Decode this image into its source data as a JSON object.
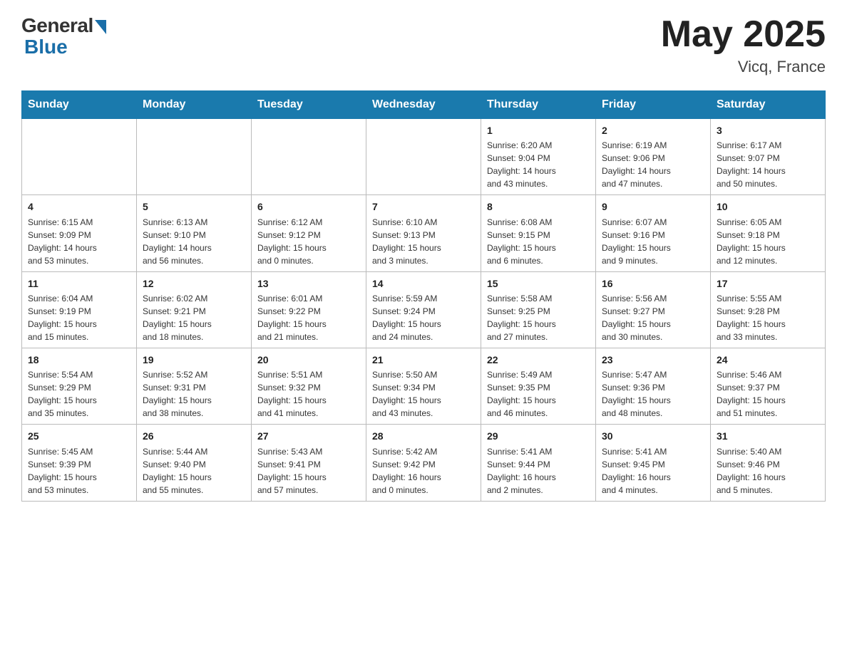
{
  "header": {
    "logo_general": "General",
    "logo_blue": "Blue",
    "month_year": "May 2025",
    "location": "Vicq, France"
  },
  "calendar": {
    "days_of_week": [
      "Sunday",
      "Monday",
      "Tuesday",
      "Wednesday",
      "Thursday",
      "Friday",
      "Saturday"
    ],
    "weeks": [
      [
        {
          "day": "",
          "info": ""
        },
        {
          "day": "",
          "info": ""
        },
        {
          "day": "",
          "info": ""
        },
        {
          "day": "",
          "info": ""
        },
        {
          "day": "1",
          "info": "Sunrise: 6:20 AM\nSunset: 9:04 PM\nDaylight: 14 hours\nand 43 minutes."
        },
        {
          "day": "2",
          "info": "Sunrise: 6:19 AM\nSunset: 9:06 PM\nDaylight: 14 hours\nand 47 minutes."
        },
        {
          "day": "3",
          "info": "Sunrise: 6:17 AM\nSunset: 9:07 PM\nDaylight: 14 hours\nand 50 minutes."
        }
      ],
      [
        {
          "day": "4",
          "info": "Sunrise: 6:15 AM\nSunset: 9:09 PM\nDaylight: 14 hours\nand 53 minutes."
        },
        {
          "day": "5",
          "info": "Sunrise: 6:13 AM\nSunset: 9:10 PM\nDaylight: 14 hours\nand 56 minutes."
        },
        {
          "day": "6",
          "info": "Sunrise: 6:12 AM\nSunset: 9:12 PM\nDaylight: 15 hours\nand 0 minutes."
        },
        {
          "day": "7",
          "info": "Sunrise: 6:10 AM\nSunset: 9:13 PM\nDaylight: 15 hours\nand 3 minutes."
        },
        {
          "day": "8",
          "info": "Sunrise: 6:08 AM\nSunset: 9:15 PM\nDaylight: 15 hours\nand 6 minutes."
        },
        {
          "day": "9",
          "info": "Sunrise: 6:07 AM\nSunset: 9:16 PM\nDaylight: 15 hours\nand 9 minutes."
        },
        {
          "day": "10",
          "info": "Sunrise: 6:05 AM\nSunset: 9:18 PM\nDaylight: 15 hours\nand 12 minutes."
        }
      ],
      [
        {
          "day": "11",
          "info": "Sunrise: 6:04 AM\nSunset: 9:19 PM\nDaylight: 15 hours\nand 15 minutes."
        },
        {
          "day": "12",
          "info": "Sunrise: 6:02 AM\nSunset: 9:21 PM\nDaylight: 15 hours\nand 18 minutes."
        },
        {
          "day": "13",
          "info": "Sunrise: 6:01 AM\nSunset: 9:22 PM\nDaylight: 15 hours\nand 21 minutes."
        },
        {
          "day": "14",
          "info": "Sunrise: 5:59 AM\nSunset: 9:24 PM\nDaylight: 15 hours\nand 24 minutes."
        },
        {
          "day": "15",
          "info": "Sunrise: 5:58 AM\nSunset: 9:25 PM\nDaylight: 15 hours\nand 27 minutes."
        },
        {
          "day": "16",
          "info": "Sunrise: 5:56 AM\nSunset: 9:27 PM\nDaylight: 15 hours\nand 30 minutes."
        },
        {
          "day": "17",
          "info": "Sunrise: 5:55 AM\nSunset: 9:28 PM\nDaylight: 15 hours\nand 33 minutes."
        }
      ],
      [
        {
          "day": "18",
          "info": "Sunrise: 5:54 AM\nSunset: 9:29 PM\nDaylight: 15 hours\nand 35 minutes."
        },
        {
          "day": "19",
          "info": "Sunrise: 5:52 AM\nSunset: 9:31 PM\nDaylight: 15 hours\nand 38 minutes."
        },
        {
          "day": "20",
          "info": "Sunrise: 5:51 AM\nSunset: 9:32 PM\nDaylight: 15 hours\nand 41 minutes."
        },
        {
          "day": "21",
          "info": "Sunrise: 5:50 AM\nSunset: 9:34 PM\nDaylight: 15 hours\nand 43 minutes."
        },
        {
          "day": "22",
          "info": "Sunrise: 5:49 AM\nSunset: 9:35 PM\nDaylight: 15 hours\nand 46 minutes."
        },
        {
          "day": "23",
          "info": "Sunrise: 5:47 AM\nSunset: 9:36 PM\nDaylight: 15 hours\nand 48 minutes."
        },
        {
          "day": "24",
          "info": "Sunrise: 5:46 AM\nSunset: 9:37 PM\nDaylight: 15 hours\nand 51 minutes."
        }
      ],
      [
        {
          "day": "25",
          "info": "Sunrise: 5:45 AM\nSunset: 9:39 PM\nDaylight: 15 hours\nand 53 minutes."
        },
        {
          "day": "26",
          "info": "Sunrise: 5:44 AM\nSunset: 9:40 PM\nDaylight: 15 hours\nand 55 minutes."
        },
        {
          "day": "27",
          "info": "Sunrise: 5:43 AM\nSunset: 9:41 PM\nDaylight: 15 hours\nand 57 minutes."
        },
        {
          "day": "28",
          "info": "Sunrise: 5:42 AM\nSunset: 9:42 PM\nDaylight: 16 hours\nand 0 minutes."
        },
        {
          "day": "29",
          "info": "Sunrise: 5:41 AM\nSunset: 9:44 PM\nDaylight: 16 hours\nand 2 minutes."
        },
        {
          "day": "30",
          "info": "Sunrise: 5:41 AM\nSunset: 9:45 PM\nDaylight: 16 hours\nand 4 minutes."
        },
        {
          "day": "31",
          "info": "Sunrise: 5:40 AM\nSunset: 9:46 PM\nDaylight: 16 hours\nand 5 minutes."
        }
      ]
    ]
  }
}
